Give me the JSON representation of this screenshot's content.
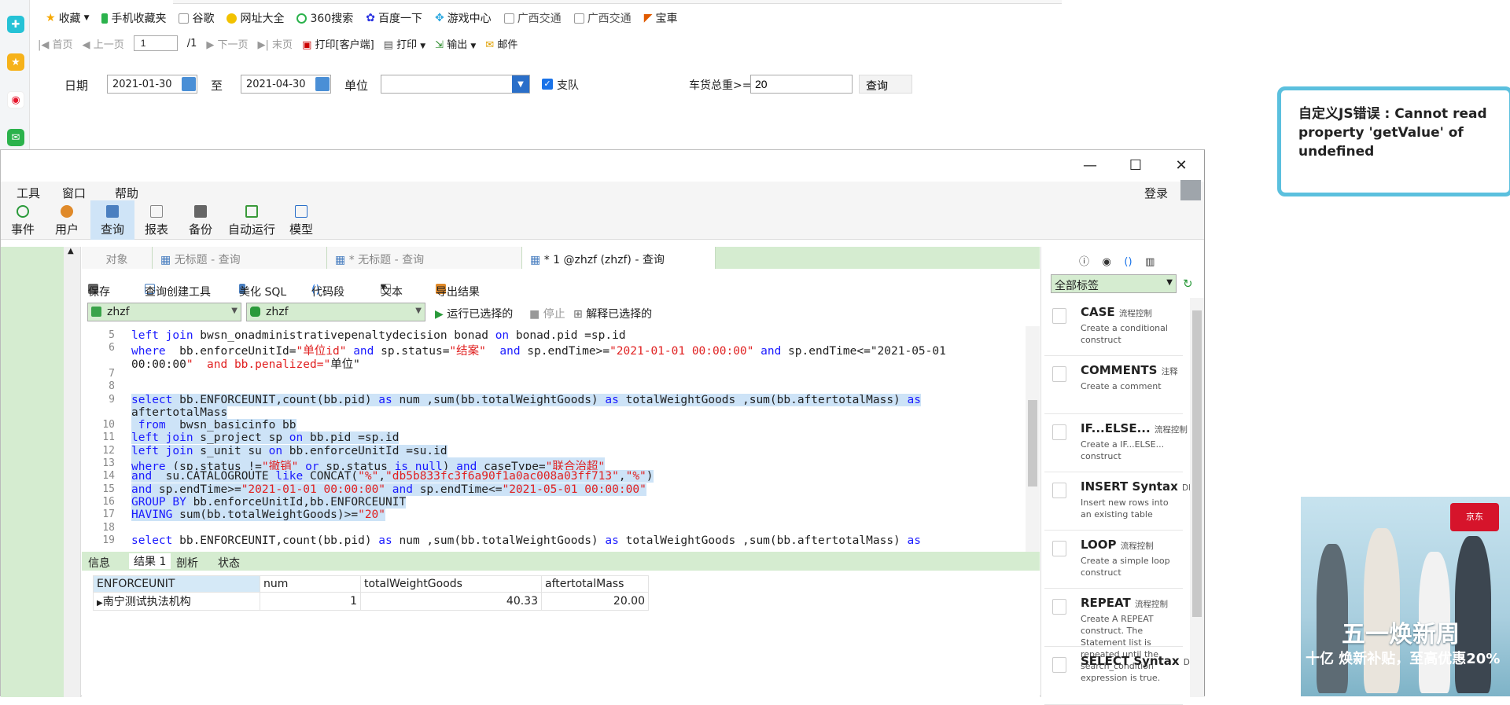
{
  "bookmarks": [
    "收藏",
    "手机收藏夹",
    "谷歌",
    "网址大全",
    "360搜索",
    "百度一下",
    "游戏中心",
    "广西交通",
    "广西交通",
    "宝車"
  ],
  "report_toolbar": {
    "first": "首页",
    "prev": "上一页",
    "page_value": "1",
    "page_total": "/1",
    "next": "下一页",
    "last": "末页",
    "print_client": "打印[客户端]",
    "print": "打印",
    "export": "输出",
    "mail": "邮件"
  },
  "filter": {
    "date_label": "日期",
    "date_from": "2021-01-30",
    "to_label": "至",
    "date_to": "2021-04-30",
    "unit_label": "单位",
    "unit_value": "",
    "checkbox_label": "支队",
    "checkbox_checked": true,
    "weight_label": "车货总重>=",
    "weight_value": "20",
    "query_button": "查询"
  },
  "error_message": "自定义JS错误 : Cannot read property 'getValue' of undefined",
  "ad": {
    "brand": "京东",
    "headline": "五一焕新周",
    "sub": "十亿 焕新补贴，至高优惠20%"
  },
  "navicat": {
    "menu": [
      "工具",
      "窗口",
      "帮助"
    ],
    "ribbon": [
      "事件",
      "用户",
      "查询",
      "报表",
      "备份",
      "自动运行",
      "模型"
    ],
    "login": "登录",
    "tabs": [
      "对象",
      "无标题 - 查询",
      "* 无标题 - 查询",
      "* 1 @zhzf (zhzf) - 查询"
    ],
    "query_toolbar": {
      "save": "保存",
      "builder": "查询创建工具",
      "beautify": "美化 SQL",
      "snippet": "代码段",
      "text": "文本",
      "export": "导出结果"
    },
    "connection": "zhzf",
    "database": "zhzf",
    "run_selected": "运行已选择的",
    "stop": "停止",
    "explain_selected": "解释已选择的",
    "editor_lines": [
      {
        "n": "5",
        "text": "left join bwsn_onadministrativepenaltydecision bonad on bonad.pid =sp.id"
      },
      {
        "n": "6",
        "text": "where  bb.enforceUnitId=\"单位id\" and sp.status=\"结案\"  and sp.endTime>=\"2021-01-01 00:00:00\" and sp.endTime<=\"2021-05-01"
      },
      {
        "n": "",
        "text": "00:00:00\"  and bb.penalized=\"单位\""
      },
      {
        "n": "7",
        "text": ""
      },
      {
        "n": "8",
        "text": ""
      },
      {
        "n": "9",
        "text": "select bb.ENFORCEUNIT,count(bb.pid) as num ,sum(bb.totalWeightGoods) as totalWeightGoods ,sum(bb.aftertotalMass) as"
      },
      {
        "n": "",
        "text": "aftertotalMass"
      },
      {
        "n": "10",
        "text": " from  bwsn_basicinfo bb"
      },
      {
        "n": "11",
        "text": "left join s_project sp on bb.pid =sp.id"
      },
      {
        "n": "12",
        "text": "left join s_unit su on bb.enforceUnitId =su.id"
      },
      {
        "n": "13",
        "text": "where (sp.status !=\"撤销\" or sp.status is null) and caseType=\"联合治超\""
      },
      {
        "n": "14",
        "text": "and  su.CATALOGROUTE like CONCAT(\"%\",\"db5b833fc3f6a90f1a0ac008a03ff713\",\"%\")"
      },
      {
        "n": "15",
        "text": "and sp.endTime>=\"2021-01-01 00:00:00\" and sp.endTime<=\"2021-05-01 00:00:00\""
      },
      {
        "n": "16",
        "text": "GROUP BY bb.enforceUnitId,bb.ENFORCEUNIT"
      },
      {
        "n": "17",
        "text": "HAVING sum(bb.totalWeightGoods)>=\"20\""
      },
      {
        "n": "18",
        "text": ""
      },
      {
        "n": "19",
        "text": "select bb.ENFORCEUNIT,count(bb.pid) as num ,sum(bb.totalWeightGoods) as totalWeightGoods ,sum(bb.aftertotalMass) as"
      }
    ],
    "result_tabs": [
      "信息",
      "结果 1",
      "剖析",
      "状态"
    ],
    "result_columns": [
      "ENFORCEUNIT",
      "num",
      "totalWeightGoods",
      "aftertotalMass"
    ],
    "result_rows": [
      [
        "南宁测试执法机构",
        "1",
        "40.33",
        "20.00"
      ]
    ],
    "snippet_filter": "全部标签",
    "snippets": [
      {
        "title": "CASE",
        "tag": "流程控制",
        "desc": "Create a conditional construct"
      },
      {
        "title": "COMMENTS",
        "tag": "注释",
        "desc": "Create a comment"
      },
      {
        "title": "IF...ELSE...",
        "tag": "流程控制",
        "desc": "Create a IF...ELSE... construct"
      },
      {
        "title": "INSERT Syntax",
        "tag": "DM",
        "desc": "Insert new rows into an existing table"
      },
      {
        "title": "LOOP",
        "tag": "流程控制",
        "desc": "Create a simple loop construct"
      },
      {
        "title": "REPEAT",
        "tag": "流程控制",
        "desc": "Create A REPEAT construct. The Statement list is repeated until the search_condition expression is true."
      },
      {
        "title": "SELECT Syntax",
        "tag": "DM",
        "desc": ""
      }
    ]
  }
}
